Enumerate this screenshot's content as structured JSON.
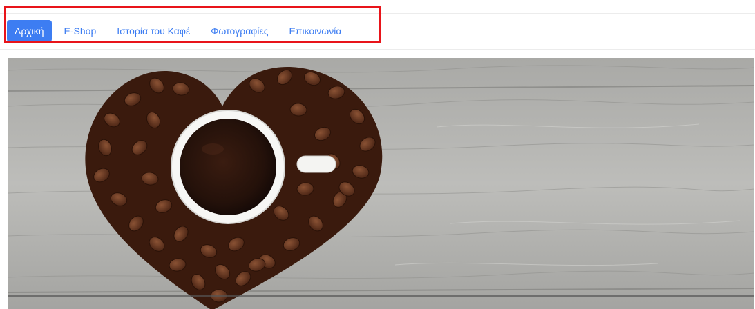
{
  "nav": {
    "items": [
      {
        "label": "Αρχική",
        "active": true
      },
      {
        "label": "E-Shop",
        "active": false
      },
      {
        "label": "Ιστορία του Καφέ",
        "active": false
      },
      {
        "label": "Φωτογραφίες",
        "active": false
      },
      {
        "label": "Επικοινωνία",
        "active": false
      }
    ],
    "active_color": "#3d7df2",
    "link_color": "#3d7df2"
  },
  "annotation": {
    "highlight_color": "#e8141a"
  },
  "hero": {
    "image": "coffee-cup-on-heart-of-beans-over-wooden-table",
    "wood_color": "#b3b3b1",
    "coffee_color": "#2a140c"
  }
}
